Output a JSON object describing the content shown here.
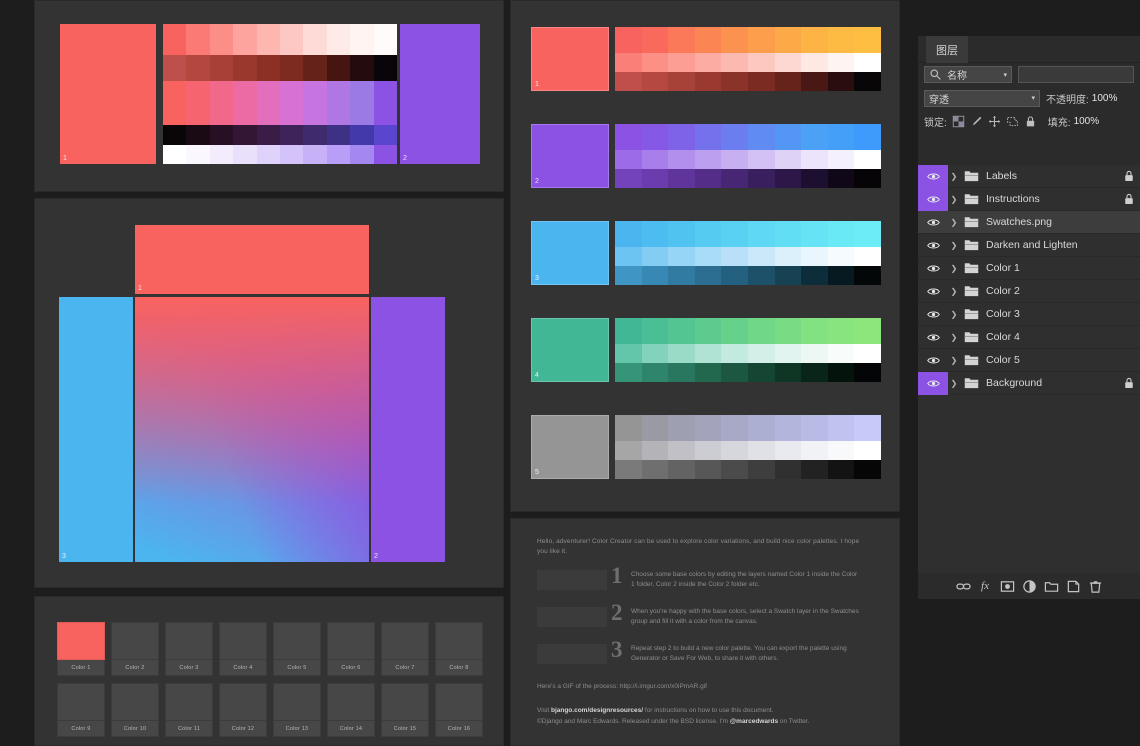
{
  "app": {
    "title": "Photoshop Color Creator document"
  },
  "layers_panel": {
    "tab_label": "图层",
    "collapse_icon": "chevron-left-icon",
    "filter": {
      "kind_label": "名称",
      "search_icon": "search-icon",
      "chevron": "chevron-down-icon",
      "value": ""
    },
    "blend_mode": "穿透",
    "opacity_label": "不透明度:",
    "opacity_value": "100%",
    "lock_label": "锁定:",
    "lock_icons": [
      "transparency-lock-icon",
      "brush-lock-icon",
      "move-lock-icon",
      "artboard-lock-icon",
      "all-lock-icon"
    ],
    "fill_label": "填充:",
    "fill_value": "100%",
    "items": [
      {
        "name": "Labels",
        "visible": true,
        "selected": false,
        "locked": true,
        "group": true
      },
      {
        "name": "Instructions",
        "visible": true,
        "selected": false,
        "locked": true,
        "group": true
      },
      {
        "name": "Swatches.png",
        "visible": true,
        "selected": true,
        "locked": false,
        "group": true
      },
      {
        "name": "Darken and Lighten",
        "visible": true,
        "selected": false,
        "locked": false,
        "group": true
      },
      {
        "name": "Color 1",
        "visible": true,
        "selected": false,
        "locked": false,
        "group": true
      },
      {
        "name": "Color 2",
        "visible": true,
        "selected": false,
        "locked": false,
        "group": true
      },
      {
        "name": "Color 3",
        "visible": true,
        "selected": false,
        "locked": false,
        "group": true
      },
      {
        "name": "Color 4",
        "visible": true,
        "selected": false,
        "locked": false,
        "group": true
      },
      {
        "name": "Color 5",
        "visible": true,
        "selected": false,
        "locked": false,
        "group": true
      },
      {
        "name": "Background",
        "visible": true,
        "selected": false,
        "locked": true,
        "group": true
      }
    ],
    "bottom_buttons": [
      {
        "icon": "link-icon",
        "label": ""
      },
      {
        "icon": "fx-icon",
        "label": "fx"
      },
      {
        "icon": "layer-mask-icon",
        "label": ""
      },
      {
        "icon": "adjustment-layer-icon",
        "label": ""
      },
      {
        "icon": "new-group-icon",
        "label": ""
      },
      {
        "icon": "new-layer-icon",
        "label": ""
      },
      {
        "icon": "delete-layer-icon",
        "label": ""
      }
    ]
  },
  "palette": {
    "base_colors": {
      "color1": "#f9635f",
      "color2": "#8b52e4",
      "color3": "#4bb5f0",
      "color4": "#42b796",
      "color5": "#959595"
    }
  },
  "swatch_rows": [
    {
      "index": "1",
      "base": "#f9635f",
      "band_top": [
        "#f9635f",
        "#fa6a5c",
        "#fb7858",
        "#fb8553",
        "#fb9250",
        "#fc9e4c",
        "#fca948",
        "#fdb445",
        "#fdbb43",
        "#fdbe42"
      ],
      "band_mid": [
        "#fb7f79",
        "#fc8f86",
        "#fc9e94",
        "#fcaca3",
        "#fcb9b1",
        "#fdc8c0",
        "#fdd7d1",
        "#fee8e3",
        "#fef4f2",
        "#ffffff"
      ],
      "band_bot": [
        "#c04e4a",
        "#b5493f",
        "#a74238",
        "#99392f",
        "#8b3229",
        "#7c2b22",
        "#66231c",
        "#4a1814",
        "#2a0e0f",
        "#080607"
      ]
    },
    {
      "index": "2",
      "base": "#8b52e4",
      "band_top": [
        "#8b52e4",
        "#8558e6",
        "#7e63e9",
        "#7570ec",
        "#6b7def",
        "#5f8bf2",
        "#5496f4",
        "#4ba1f6",
        "#449ff8",
        "#3f9bfb"
      ],
      "band_mid": [
        "#9b6be8",
        "#a77eea",
        "#b28fec",
        "#bd9fef",
        "#c7b0f1",
        "#d3c0f4",
        "#dfd2f7",
        "#ebe4fa",
        "#f5f0fd",
        "#ffffff"
      ],
      "band_bot": [
        "#7243bb",
        "#6a3cae",
        "#5f359c",
        "#532d88",
        "#472674",
        "#3a1f5f",
        "#2c1748",
        "#1d0f30",
        "#100818",
        "#060406"
      ]
    },
    {
      "index": "3",
      "base": "#4bb5f0",
      "band_top": [
        "#4bb5f0",
        "#4dbcf1",
        "#51c3f1",
        "#55cbf2",
        "#59d1f3",
        "#5ed8f4",
        "#62def4",
        "#66e4f5",
        "#69e9f6",
        "#6cecf7"
      ],
      "band_mid": [
        "#6cc4f2",
        "#83cdf4",
        "#96d5f5",
        "#a9ddf7",
        "#badff8",
        "#cbe8fa",
        "#dcf0fb",
        "#eaf6fd",
        "#f6fbfe",
        "#ffffff"
      ],
      "band_bot": [
        "#3f95c4",
        "#3888b5",
        "#317aa2",
        "#2b6e92",
        "#24607f",
        "#1d5169",
        "#164254",
        "#0e2d3a",
        "#071a22",
        "#040708"
      ]
    },
    {
      "index": "4",
      "base": "#42b796",
      "band_top": [
        "#42b796",
        "#4abe95",
        "#53c592",
        "#5dcb8e",
        "#66d18b",
        "#70d787",
        "#79dc84",
        "#82e180",
        "#88e47e",
        "#8ce67c"
      ],
      "band_mid": [
        "#63c5a9",
        "#83d2bb",
        "#9adbc8",
        "#b0e3d4",
        "#c3eade",
        "#d3efe7",
        "#e1f4ef",
        "#edf8f5",
        "#f8fcfb",
        "#ffffff"
      ],
      "band_bot": [
        "#369479",
        "#2f856b",
        "#28775e",
        "#22684f",
        "#1b5741",
        "#154633",
        "#0f3525",
        "#092418",
        "#05130d",
        "#030506"
      ]
    },
    {
      "index": "5",
      "base": "#959595",
      "band_top": [
        "#959595",
        "#999aa3",
        "#9e9fb0",
        "#a3a4bc",
        "#a8a9c7",
        "#adafd2",
        "#b3b5dd",
        "#b9bbe7",
        "#c0c2f0",
        "#c7caf9"
      ],
      "band_mid": [
        "#a6a6a6",
        "#b3b3b8",
        "#c0c0c6",
        "#cccdd3",
        "#d6d7dd",
        "#e0e1e6",
        "#e9eaef",
        "#f1f2f6",
        "#f8f9fb",
        "#ffffff"
      ],
      "band_bot": [
        "#7a7a7a",
        "#6f6f6f",
        "#636363",
        "#575757",
        "#4b4b4b",
        "#3e3e3e",
        "#303030",
        "#222222",
        "#131313",
        "#060606"
      ]
    }
  ],
  "color_grid": {
    "cells": [
      {
        "label": "Color 1",
        "filled": true
      },
      {
        "label": "Color 2",
        "filled": false
      },
      {
        "label": "Color 3",
        "filled": false
      },
      {
        "label": "Color 4",
        "filled": false
      },
      {
        "label": "Color 5",
        "filled": false
      },
      {
        "label": "Color 6",
        "filled": false
      },
      {
        "label": "Color 7",
        "filled": false
      },
      {
        "label": "Color 8",
        "filled": false
      },
      {
        "label": "Color 9",
        "filled": false
      },
      {
        "label": "Color 10",
        "filled": false
      },
      {
        "label": "Color 11",
        "filled": false
      },
      {
        "label": "Color 12",
        "filled": false
      },
      {
        "label": "Color 13",
        "filled": false
      },
      {
        "label": "Color 14",
        "filled": false
      },
      {
        "label": "Color 15",
        "filled": false
      },
      {
        "label": "Color 16",
        "filled": false
      }
    ]
  },
  "instructions": {
    "intro": "Hello, adventurer! Color Creator can be used to explore color variations, and build nice color palettes. I hope you like it.",
    "steps": [
      {
        "num": "1",
        "text": "Choose some base colors by editing the layers named Color 1 inside the Color 1 folder, Color 2 inside the Color 2 folder etc."
      },
      {
        "num": "2",
        "text": "When you're happy with the base colors, select a Swatch layer in the Swatches group and fill it with a color from the canvas."
      },
      {
        "num": "3",
        "text": "Repeat step 2 to build a new color palette. You can export the palette using Generator or Save For Web, to share it with others."
      }
    ],
    "gif_note": "Here's a GIF of the process: http://i.imgur.com/x0iPmAR.gif",
    "credit_prefix": "Visit ",
    "credit_link": "bjango.com/designresources/",
    "credit_mid": " for instructions on how to use this document.",
    "credit_line2_a": "©Django and Marc Edwards. Released under the BSD license. I'm ",
    "credit_link2": "@marcedwards",
    "credit_line2_b": " on Twitter."
  },
  "blend_panel": {
    "swatch_top": "#f9635f",
    "swatch_left": "#4bb5f0",
    "swatch_right": "#8b52e4",
    "label_top": "1",
    "label_left": "3",
    "label_right": "2"
  },
  "top_panel": {
    "left_color": "#f9635f",
    "right_color": "#8b52e4",
    "label_left": "1",
    "label_right": "2",
    "rowA": [
      "#f9635f",
      "#fb7a75",
      "#fc8e88",
      "#fca49d",
      "#fdb6b0",
      "#fdc8c3",
      "#fedbd7",
      "#feeae7",
      "#fff4f2",
      "#fffbfa"
    ],
    "rowB": [
      "#bf4f4a",
      "#b5483e",
      "#a94036",
      "#9b382d",
      "#8c3026",
      "#7d2a20",
      "#652219",
      "#461512",
      "#230b0e",
      "#090509"
    ],
    "rowC": [
      "#f9635f",
      "#f6656f",
      "#f2688a",
      "#ec6ba5",
      "#e36ebd",
      "#d771d3",
      "#c674e0",
      "#b077e4",
      "#9b7ae6",
      "#8b52e4"
    ],
    "rowD": [
      "#0a0608",
      "#190a14",
      "#281024",
      "#331634",
      "#3a1c47",
      "#3d2359",
      "#3e2a6d",
      "#3d3186",
      "#4439ab",
      "#5a45cf"
    ],
    "rowE": [
      "#ffffff",
      "#faf7fe",
      "#f2ecfd",
      "#e9e0fc",
      "#dfd2fb",
      "#d4c3fa",
      "#c7b2f8",
      "#b89ef6",
      "#a487f0",
      "#8b52e4"
    ]
  }
}
